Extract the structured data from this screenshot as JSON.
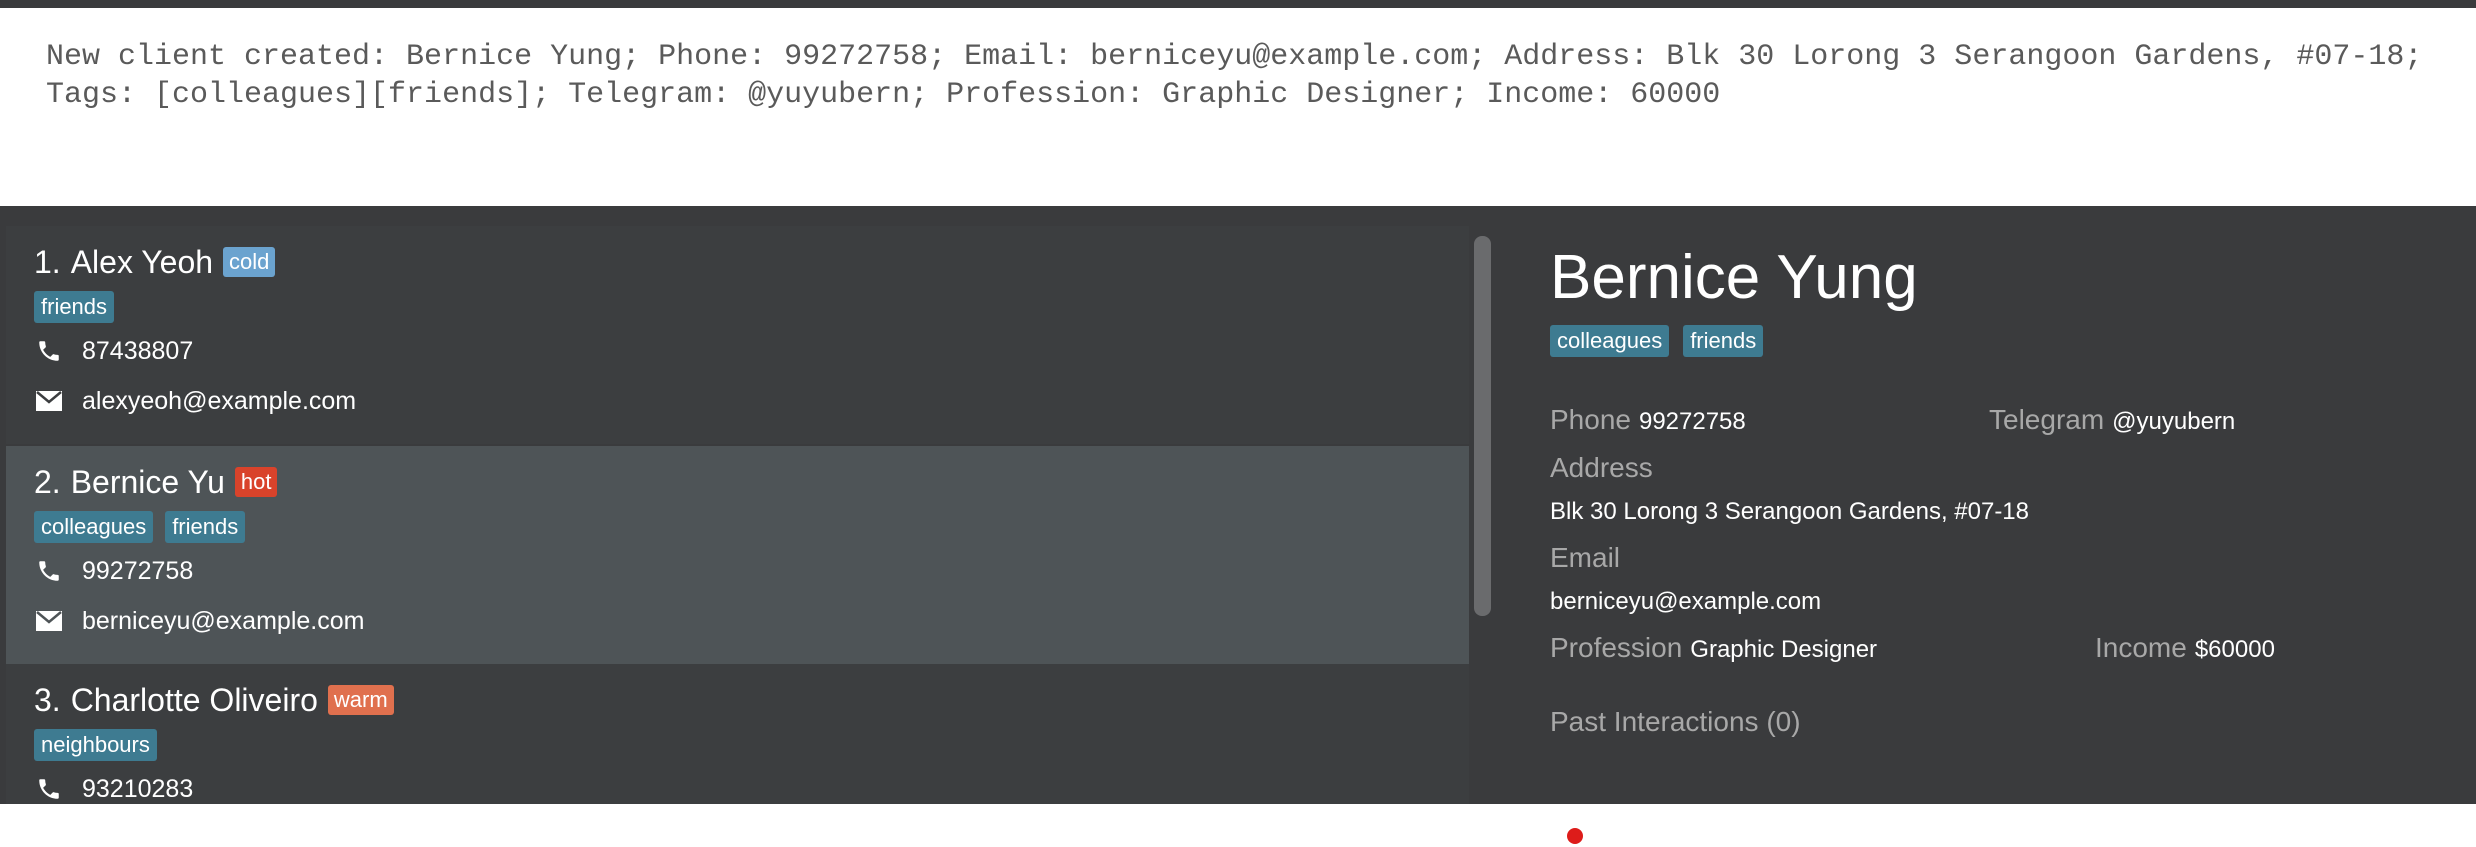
{
  "result_display": {
    "text": "New client created: Bernice Yung; Phone: 99272758; Email: berniceyu@example.com; Address: Blk 30 Lorong 3 Serangoon Gardens, #07-18; Tags: [colleagues][friends]; Telegram: @yuyubern; Profession: Graphic Designer; Income: 60000"
  },
  "client_list": [
    {
      "index": "1.",
      "name": "Alex Yeoh",
      "status": "cold",
      "status_color": "#6ba3cf",
      "tags": [
        "friends"
      ],
      "phone": "87438807",
      "email": "alexyeoh@example.com",
      "selected": false
    },
    {
      "index": "2.",
      "name": "Bernice Yu",
      "status": "hot",
      "status_color": "#d9432b",
      "tags": [
        "colleagues",
        "friends"
      ],
      "phone": "99272758",
      "email": "berniceyu@example.com",
      "selected": true
    },
    {
      "index": "3.",
      "name": "Charlotte Oliveiro",
      "status": "warm",
      "status_color": "#e0704e",
      "tags": [
        "neighbours"
      ],
      "phone": "93210283",
      "email": "",
      "selected": false
    }
  ],
  "icons": {
    "phone": "phone-icon",
    "email": "envelope-icon"
  },
  "details": {
    "name": "Bernice Yung",
    "tags": [
      "colleagues",
      "friends"
    ],
    "phone_label": "Phone",
    "phone": "99272758",
    "telegram_label": "Telegram",
    "telegram": "@yuyubern",
    "address_label": "Address",
    "address": "Blk 30 Lorong 3 Serangoon Gardens, #07-18",
    "email_label": "Email",
    "email": "berniceyu@example.com",
    "profession_label": "Profession",
    "profession": "Graphic Designer",
    "income_label": "Income",
    "income": "$60000",
    "past_interactions_label": "Past Interactions (0)"
  },
  "colors": {
    "background_dark": "#3a3b3d",
    "card": "#3c3e40",
    "card_selected": "#4e5457",
    "tag": "#3e7b91",
    "label_gray": "#a8a8a8",
    "indicator_red": "#dd1c1a"
  }
}
